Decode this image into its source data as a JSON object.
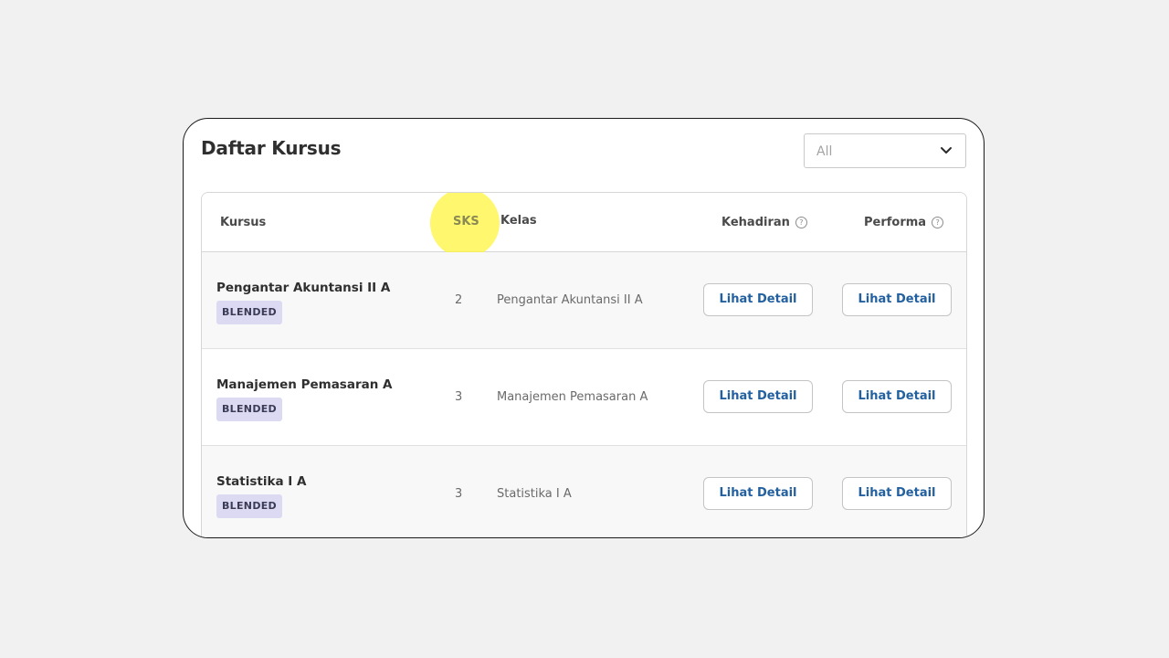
{
  "card": {
    "title": "Daftar Kursus"
  },
  "filter": {
    "selected": "All",
    "icon": "chevron-down-icon"
  },
  "table": {
    "columns": {
      "kursus": "Kursus",
      "sks": "SKS",
      "kelas": "Kelas",
      "kehadiran": "Kehadiran",
      "performa": "Performa"
    },
    "help_icon": "?",
    "rows": [
      {
        "course": "Pengantar Akuntansi II A",
        "badge": "BLENDED",
        "sks": "2",
        "kelas": "Pengantar Akuntansi II A",
        "kehadiran_button": "Lihat Detail",
        "performa_button": "Lihat Detail"
      },
      {
        "course": "Manajemen Pemasaran A",
        "badge": "BLENDED",
        "sks": "3",
        "kelas": "Manajemen Pemasaran A",
        "kehadiran_button": "Lihat Detail",
        "performa_button": "Lihat Detail"
      },
      {
        "course": "Statistika I A",
        "badge": "BLENDED",
        "sks": "3",
        "kelas": "Statistika I A",
        "kehadiran_button": "Lihat Detail",
        "performa_button": "Lihat Detail"
      }
    ]
  },
  "colors": {
    "background": "#f1f1f1",
    "badge_bg": "#dcdaf3",
    "link_blue": "#23609f",
    "highlight": "#fff43c"
  }
}
